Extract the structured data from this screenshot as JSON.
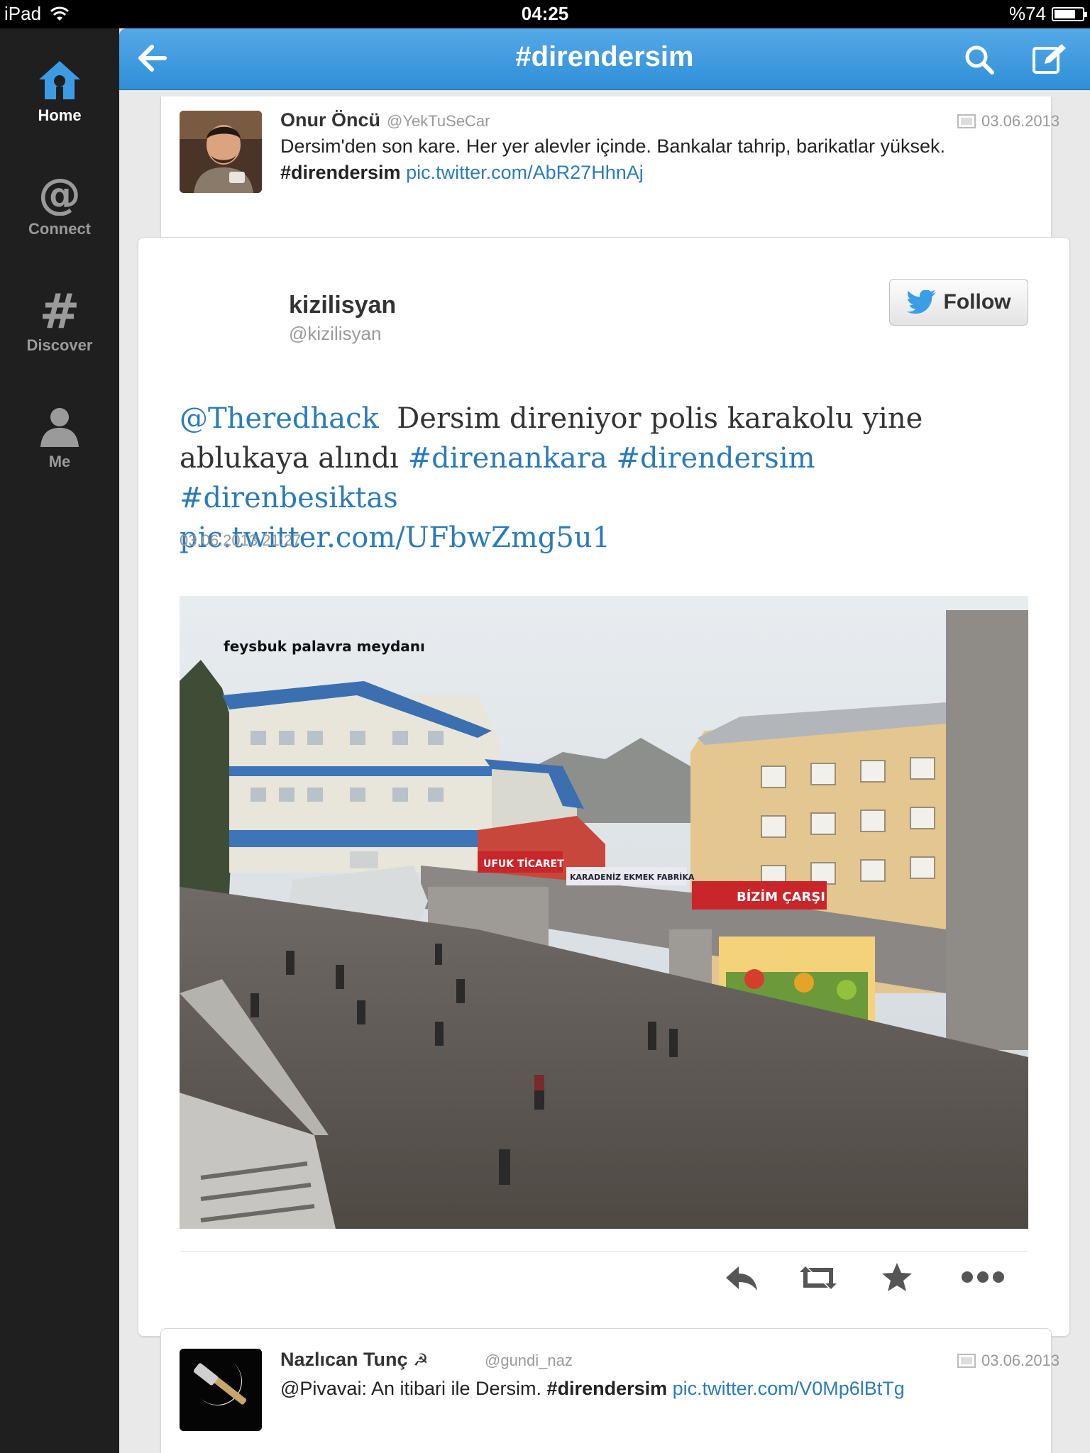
{
  "status_bar": {
    "device": "iPad",
    "time": "04:25",
    "battery": "%74"
  },
  "sidebar": {
    "items": [
      {
        "label": "Home",
        "icon": "home-icon"
      },
      {
        "label": "Connect",
        "icon": "at-icon"
      },
      {
        "label": "Discover",
        "icon": "hash-icon"
      },
      {
        "label": "Me",
        "icon": "person-icon"
      }
    ]
  },
  "header": {
    "title": "#direndersim"
  },
  "tweets": [
    {
      "name": "Onur Öncü",
      "handle": "@YekTuSeCar",
      "date": "03.06.2013",
      "text": "Dersim'den son kare. Her yer alevler içinde. Bankalar tahrip, barikatlar yüksek.",
      "hashtag": "#direndersim",
      "link": "pic.twitter.com/AbR27HhnAj"
    },
    {
      "name": "Nazlıcan Tunç",
      "name_symbol": "☭",
      "handle": "@gundi_naz",
      "date": "03.06.2013",
      "text": "@Pivavai: An itibari ile Dersim.",
      "hashtag": "#direndersim",
      "link": "pic.twitter.com/V0Mp6lBtTg"
    }
  ],
  "embed": {
    "name": "kizilisyan",
    "handle": "@kizilisyan",
    "follow_label": "Follow",
    "mention": "@Theredhack",
    "text": "  Dersim direniyor polis karakolu yine ablukaya alındı ",
    "hashtags": [
      "#direnankara",
      "#direndersim",
      "#direnbesiktas"
    ],
    "link": "pic.twitter.com/UFbwZmg5u1",
    "timestamp": "03.06.2013 21:27",
    "photo_caption": "feysbuk palavra meydanı",
    "photo_signs": [
      "UFUK TİCARET",
      "KARADENİZ EKMEK FABRİKA",
      "BİZİM ÇARŞI"
    ]
  },
  "colors": {
    "header_blue": "#3a97dd",
    "link_blue": "#2b7bb9",
    "sidebar_bg": "#1f1f1f"
  }
}
